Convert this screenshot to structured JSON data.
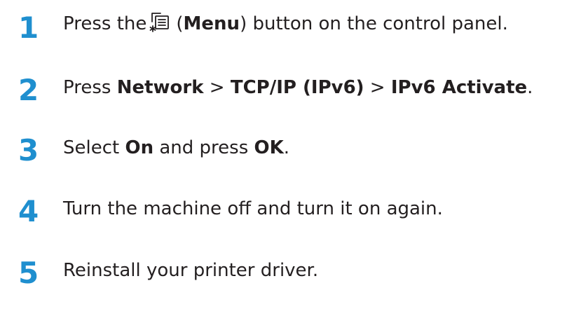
{
  "steps": [
    {
      "number": "1",
      "pre": "Press the",
      "icon": "menu-icon",
      "open_paren": "(",
      "bold1": "Menu",
      "post": ") button on the control panel."
    },
    {
      "number": "2",
      "pre": "Press ",
      "bold1": "Network",
      "sep1": " > ",
      "bold2": "TCP/IP (IPv6)",
      "sep2": " > ",
      "bold3": "IPv6 Activate",
      "post": "."
    },
    {
      "number": "3",
      "pre": "Select ",
      "bold1": "On",
      "mid": " and press ",
      "bold2": "OK",
      "post": "."
    },
    {
      "number": "4",
      "text": "Turn the machine off and turn it on again."
    },
    {
      "number": "5",
      "text": "Reinstall your printer driver."
    }
  ],
  "accent_color": "#1f8fcf",
  "text_color": "#231f20"
}
